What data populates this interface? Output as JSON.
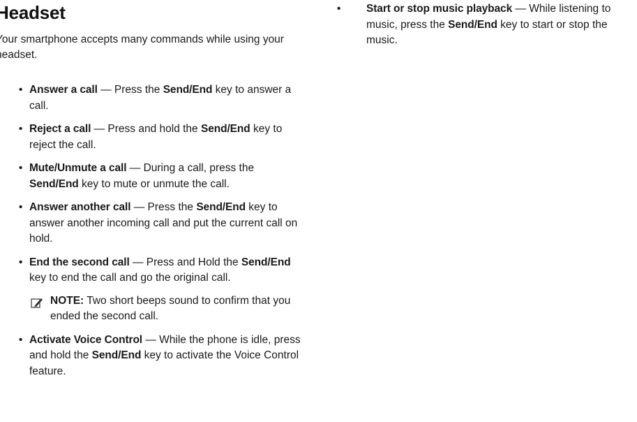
{
  "section": {
    "title": "Headset",
    "intro": "Your smartphone accepts many commands while using your headset."
  },
  "left_items": [
    {
      "term": "Answer a call",
      "parts": [
        " — Press the ",
        "Send/End",
        " key to answer a call."
      ]
    },
    {
      "term": "Reject a call",
      "parts": [
        " — Press and hold the ",
        "Send/End",
        " key to reject the call."
      ]
    },
    {
      "term": "Mute/Unmute a call",
      "parts": [
        " — During a call, press the ",
        "Send/End",
        " key to mute or unmute the call."
      ]
    },
    {
      "term": "Answer another call",
      "parts": [
        " — Press the ",
        "Send/End",
        " key to answer another incoming call and put the current call on hold."
      ]
    },
    {
      "term": "End the second call",
      "parts": [
        " — Press and Hold the ",
        "Send/End",
        " key to end the call and go the original call."
      ],
      "note": {
        "label": "NOTE:",
        "text": " Two short beeps sound to confirm that you ended the second call.",
        "icon": "note-pencil-icon"
      }
    },
    {
      "term": "Activate Voice Control",
      "parts": [
        " — While the phone is idle, press and hold the ",
        "Send/End",
        " key to activate the Voice Control feature."
      ]
    }
  ],
  "right_items": [
    {
      "term": "Start or stop music playback",
      "parts": [
        " — While listening to music, press the ",
        "Send/End",
        " key to start or stop the music."
      ]
    }
  ],
  "bullet_glyph": "•"
}
